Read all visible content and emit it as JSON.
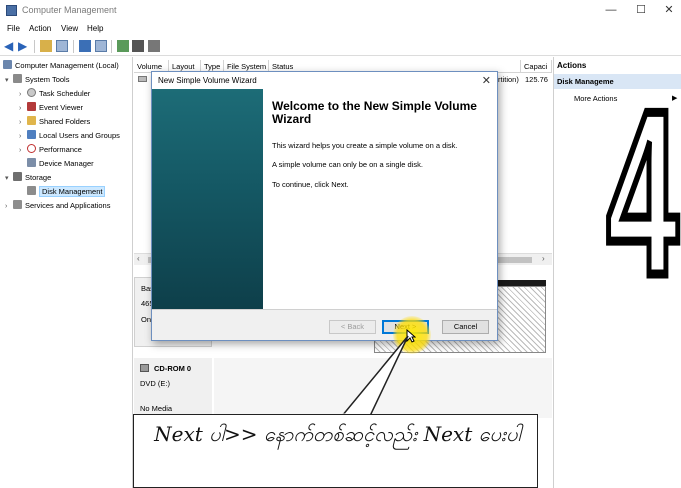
{
  "window": {
    "title": "Computer Management",
    "minimize": "—",
    "maximize": "☐",
    "close": "✕"
  },
  "menu": [
    "File",
    "Action",
    "View",
    "Help"
  ],
  "tree": [
    {
      "label": "Computer Management (Local)",
      "level": 0,
      "icon": "computer-icon"
    },
    {
      "label": "System Tools",
      "level": 1,
      "icon": "tools-icon"
    },
    {
      "label": "Task Scheduler",
      "level": 2,
      "icon": "clock-icon"
    },
    {
      "label": "Event Viewer",
      "level": 2,
      "icon": "event-viewer-icon"
    },
    {
      "label": "Shared Folders",
      "level": 2,
      "icon": "folder-icon"
    },
    {
      "label": "Local Users and Groups",
      "level": 2,
      "icon": "users-icon"
    },
    {
      "label": "Performance",
      "level": 2,
      "icon": "performance-icon"
    },
    {
      "label": "Device Manager",
      "level": 2,
      "icon": "device-manager-icon"
    },
    {
      "label": "Storage",
      "level": 1,
      "icon": "storage-icon"
    },
    {
      "label": "Disk Management",
      "level": 2,
      "icon": "disk-icon",
      "selected": true
    },
    {
      "label": "Services and Applications",
      "level": 1,
      "icon": "services-icon"
    }
  ],
  "volume_columns": [
    "Volume",
    "Layout",
    "Type",
    "File System",
    "Status",
    "Capaci"
  ],
  "volume_row": {
    "status_tail": "rtition)",
    "capacity": "125.76"
  },
  "disks": [
    {
      "label_a": "Bas",
      "label_b": "465",
      "label_c": "On"
    },
    {
      "name": "CD-ROM 0",
      "sub": "DVD (E:)",
      "media": "No Media"
    }
  ],
  "actions": {
    "header": "Actions",
    "selected": "Disk Manageme",
    "more": "More Actions"
  },
  "wizard": {
    "title": "New Simple Volume Wizard",
    "heading": "Welcome to the New Simple Volume Wizard",
    "p1": "This wizard helps you create a simple volume on a disk.",
    "p2": "A simple volume can only be on a single disk.",
    "p3": "To continue, click Next.",
    "back": "< Back",
    "next": "Next >",
    "cancel": "Cancel"
  },
  "annotation": {
    "text": "Next ပါ>> နောက်တစ်ဆင့်လည်း Next ပေးပါ"
  },
  "step_number": "4"
}
